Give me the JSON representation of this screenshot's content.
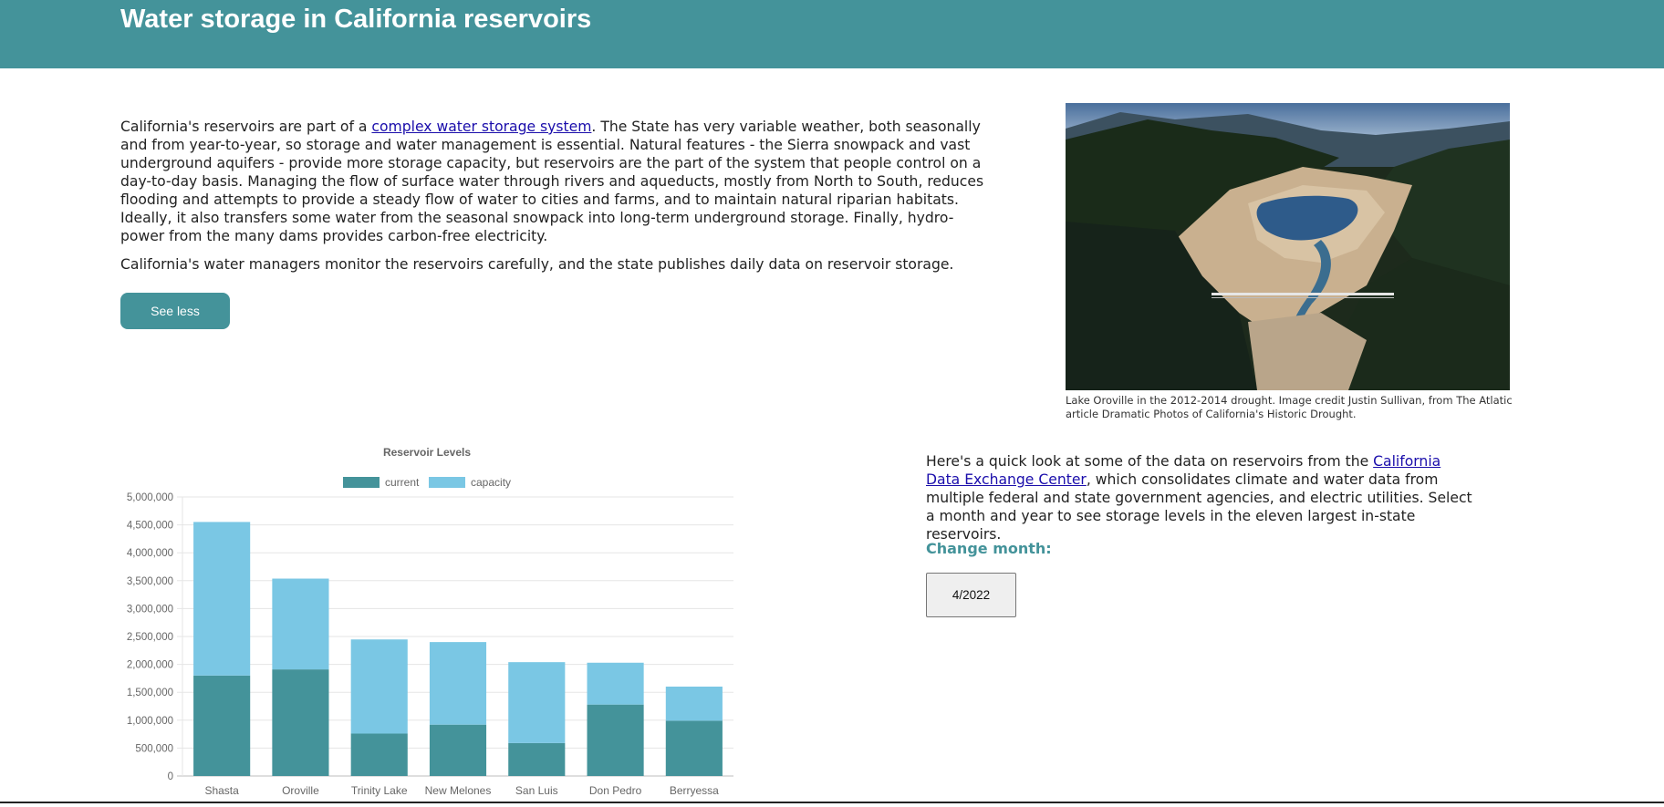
{
  "header": {
    "title": "Water storage in California reservoirs"
  },
  "intro": {
    "p1_before": "California's reservoirs are part of a ",
    "p1_link": "complex water storage system",
    "p1_after": ". The State has very variable weather, both seasonally and from year-to-year, so storage and water management is essential. Natural features - the Sierra snowpack and vast underground aquifers - provide more storage capacity, but reservoirs are the part of the system that people control on a day-to-day basis. Managing the flow of surface water through rivers and aqueducts, mostly from North to South, reduces flooding and attempts to provide a steady flow of water to cities and farms, and to maintain natural riparian habitats. Ideally, it also transfers some water from the seasonal snowpack into long-term underground storage. Finally, hydro-power from the many dams provides carbon-free electricity.",
    "p2": "California's water managers monitor the reservoirs carefully, and the state publishes daily data on reservoir storage.",
    "see_less": "See less"
  },
  "photo": {
    "caption": "Lake Oroville in the 2012-2014 drought. Image credit Justin Sullivan, from The Atlatic article Dramatic Photos of California's Historic Drought."
  },
  "quick": {
    "before": "Here's a quick look at some of the data on reservoirs from the ",
    "link": "California Data Exchange Center",
    "after": ", which consolidates climate and water data from multiple federal and state government agencies, and electric utilities. Select a month and year to see storage levels in the eleven largest in-state reservoirs.",
    "change_month_label": "Change month:",
    "month_value": "4/2022"
  },
  "colors": {
    "accent": "#44939a",
    "capacity": "#7ac7e4",
    "current": "#44939a"
  },
  "chart_data": {
    "type": "bar",
    "stacked": true,
    "title": "Reservoir Levels",
    "categories": [
      "Shasta",
      "Oroville",
      "Trinity Lake",
      "New Melones",
      "San Luis",
      "Don Pedro",
      "Berryessa"
    ],
    "series": [
      {
        "name": "current",
        "values": [
          1800000,
          1910000,
          760000,
          920000,
          590000,
          1280000,
          990000
        ]
      },
      {
        "name": "capacity",
        "values": [
          2752000,
          1627000,
          1687000,
          1480000,
          1450000,
          750000,
          612000
        ]
      }
    ],
    "y_ticks": [
      "0",
      "500,000",
      "1,000,000",
      "1,500,000",
      "2,000,000",
      "2,500,000",
      "3,000,000",
      "3,500,000",
      "4,000,000",
      "4,500,000",
      "5,000,000"
    ],
    "ylim": [
      0,
      5000000
    ],
    "grid": true,
    "legend": "top"
  }
}
